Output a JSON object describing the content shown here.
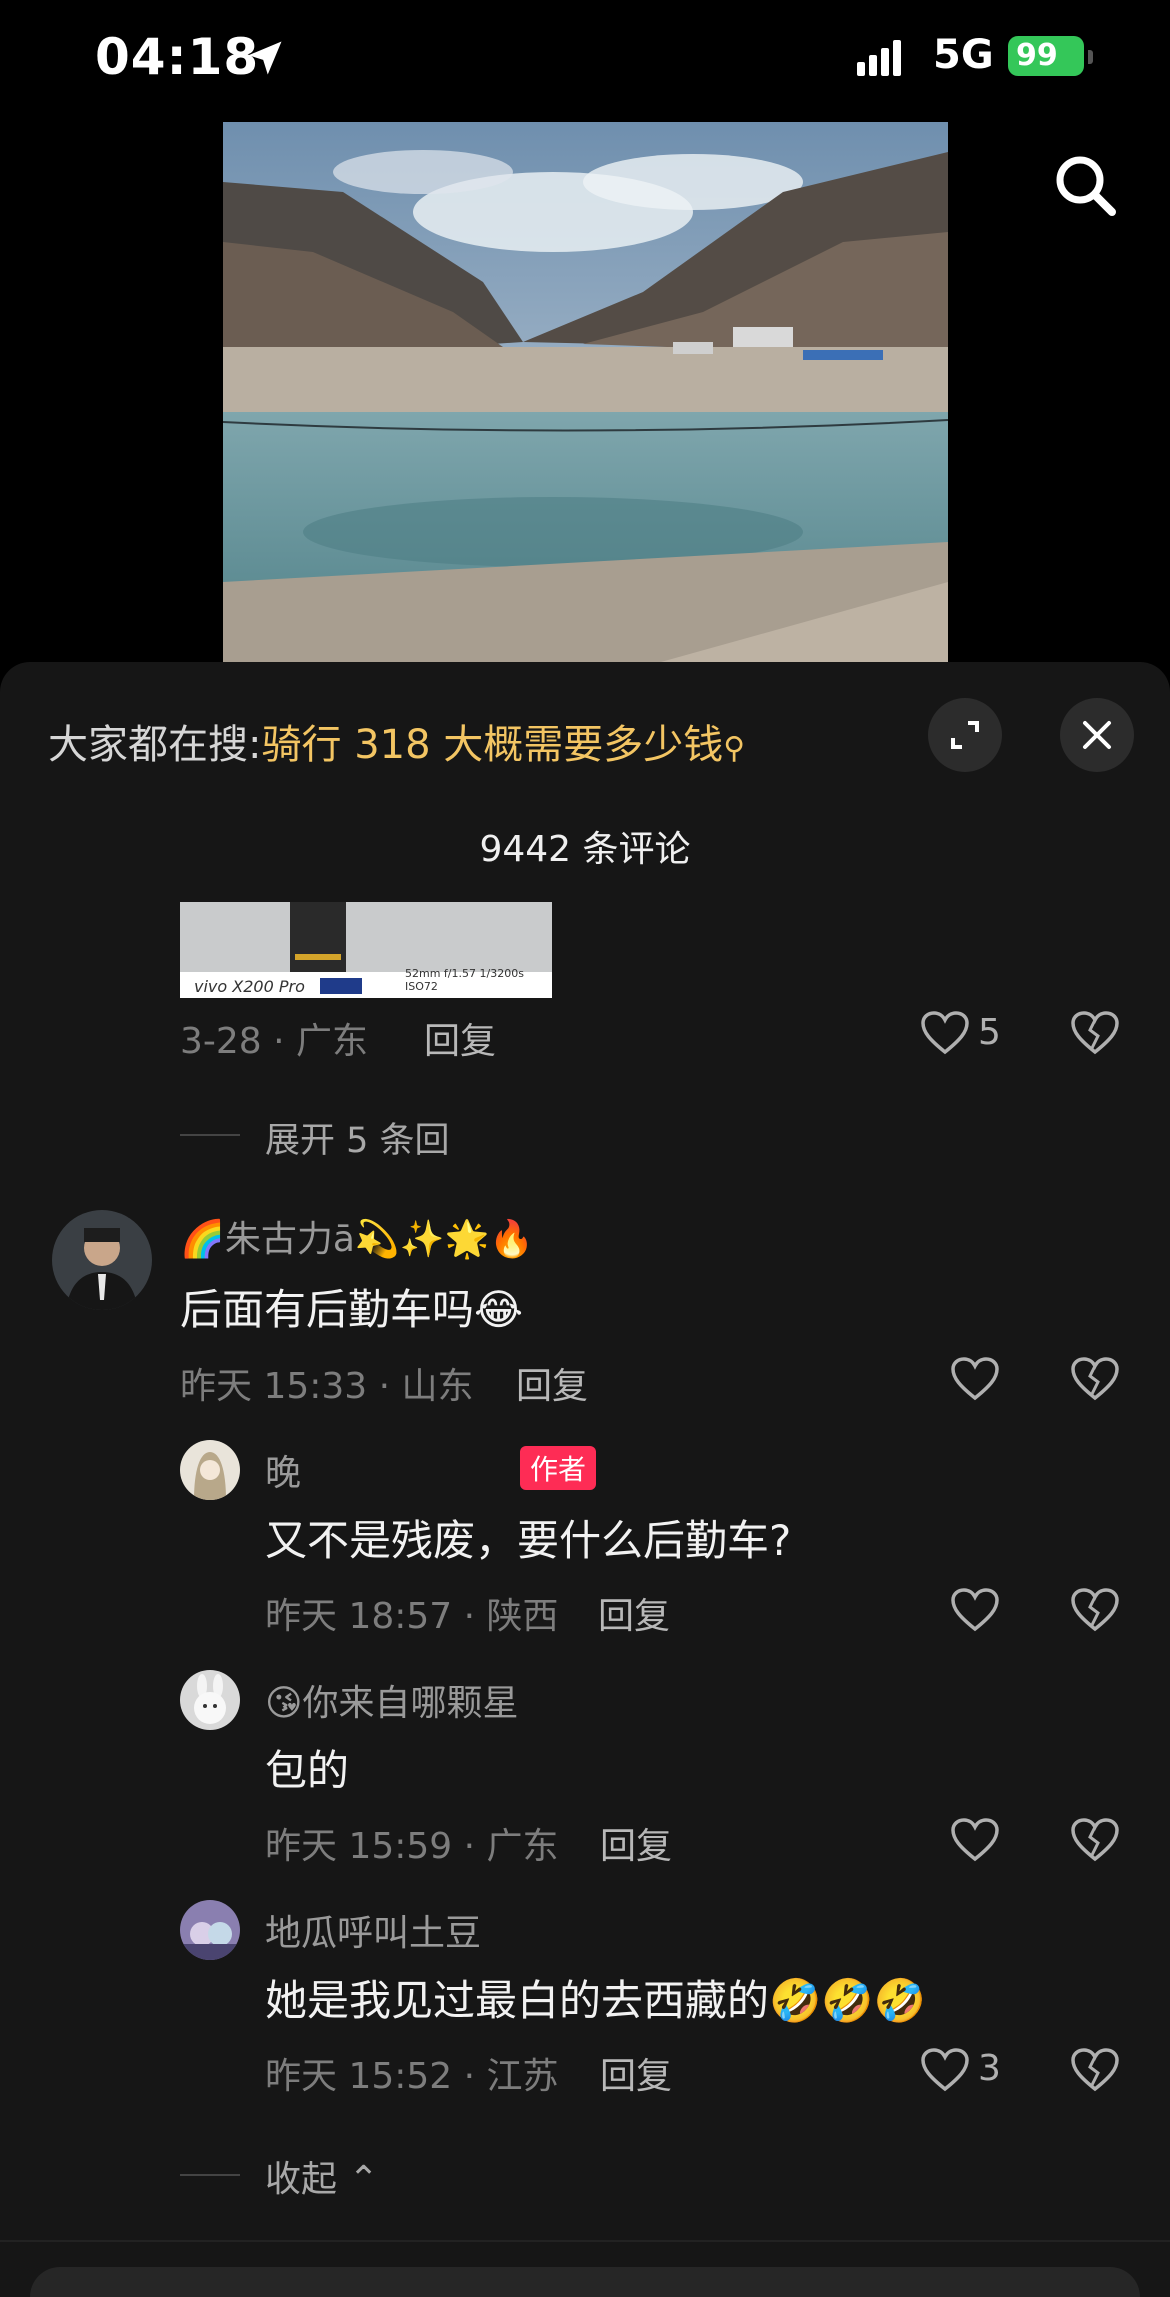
{
  "status_bar": {
    "time": "04:18",
    "network": "5G",
    "battery": "99"
  },
  "hot_search": {
    "prefix": "大家都在搜:",
    "query": "骑行 318 大概需要多少钱",
    "icon": "search-mini-icon"
  },
  "comments_header": {
    "count_label": "9442 条评论"
  },
  "partial_image": {
    "brand": "vivo X200 Pro",
    "specs": "52mm f/1.57 1/3200s ISO72"
  },
  "top_comment_meta": {
    "date_location": "3-28 · 广东",
    "reply_label": "回复",
    "like_count": "5"
  },
  "expand_replies": {
    "label": "展开 5 条回"
  },
  "main_comment": {
    "username": "🌈朱古力ā💫✨🌟🔥",
    "text": "后面有后勤车吗😂",
    "date_location": "昨天 15:33 · 山东",
    "reply_label": "回复"
  },
  "replies": [
    {
      "username": "晚",
      "author_tag": "作者",
      "text": "又不是残废，要什么后勤车?",
      "date_location": "昨天 18:57 · 陕西",
      "reply_label": "回复",
      "like_count": ""
    },
    {
      "username": "😘你来自哪颗星",
      "text": "包的",
      "date_location": "昨天 15:59 · 广东",
      "reply_label": "回复",
      "like_count": ""
    },
    {
      "username": "地瓜呼叫土豆",
      "text": "她是我见过最白的去西藏的🤣🤣🤣",
      "date_location": "昨天 15:52 · 江苏",
      "reply_label": "回复",
      "like_count": "3"
    }
  ],
  "collapse": {
    "label": "收起"
  },
  "colors": {
    "background": "#000000",
    "sheet": "#161616",
    "hot_query": "#f3c563",
    "author_tag": "#fe2c55",
    "battery": "#34c759"
  }
}
